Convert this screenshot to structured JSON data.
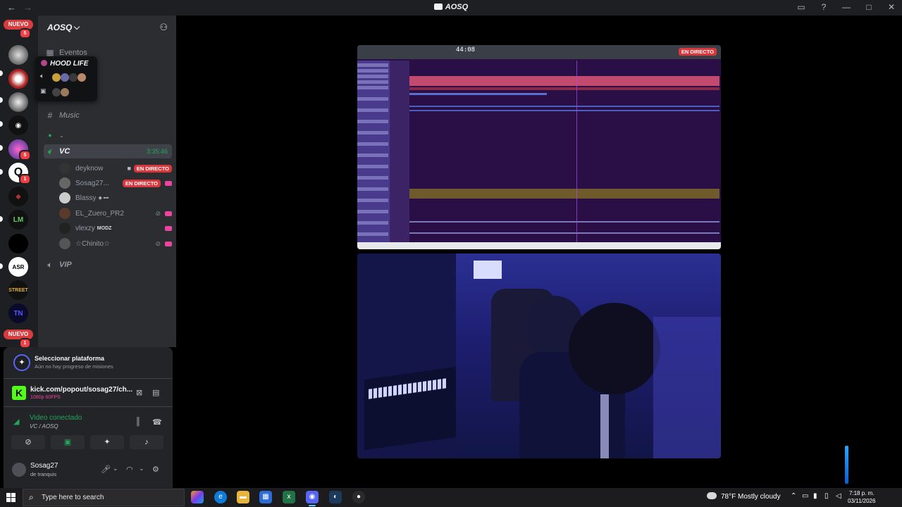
{
  "titlebar": {
    "title": "AOSQ",
    "back": "←",
    "forward": "→",
    "inbox": "▭",
    "help": "?",
    "min": "—",
    "max": "□",
    "close": "✕"
  },
  "rail": {
    "nuevo_top": "NUEVO",
    "nuevo_top_count": "5",
    "nuevo_bottom": "NUEVO",
    "nuevo_bottom_count": "1",
    "badges": {
      "srv5": "5",
      "srv6": "1"
    }
  },
  "guild": {
    "name": "AOSQ"
  },
  "channels": {
    "events": "Eventos",
    "music": "Music",
    "vc": {
      "name": "VC",
      "timer": "3:35:46"
    },
    "vip": "VIP"
  },
  "members": [
    {
      "name": "deyknow",
      "live": "EN DIRECTO"
    },
    {
      "name": "Sosag27...",
      "live": "EN DIRECTO"
    },
    {
      "name": "Blassy",
      "tag": "◈ ▪▪▪"
    },
    {
      "name": "EL_Zuero_PR2"
    },
    {
      "name": "vlexzy",
      "tag": "MODZ"
    },
    {
      "name": "☆Chinito☆"
    }
  ],
  "popup": {
    "title": "HOOD LIFE"
  },
  "quest": {
    "title": "Seleccionar plataforma",
    "subtitle": "Aún no hay progreso de misiones"
  },
  "stream": {
    "url": "kick.com/popout/sosag27/ch...",
    "quality": "1080p 60FPS"
  },
  "voice": {
    "status": "Video conectado",
    "location": "VC / AOSQ"
  },
  "user": {
    "name": "Sosag27",
    "status": "de tranquis"
  },
  "stage": {
    "live_label": "EN DIRECTO",
    "daw_tempo": "44:08"
  },
  "taskbar": {
    "search_placeholder": "Type here to search",
    "weather": "78°F  Mostly cloudy",
    "time": "7:18 p. m.",
    "date": "03/11/2026"
  },
  "colors": {
    "accent": "#5865f2",
    "live_red": "#da373c",
    "online_green": "#23a55a",
    "stream_pink": "#eb459e",
    "kick_green": "#53fc18"
  }
}
